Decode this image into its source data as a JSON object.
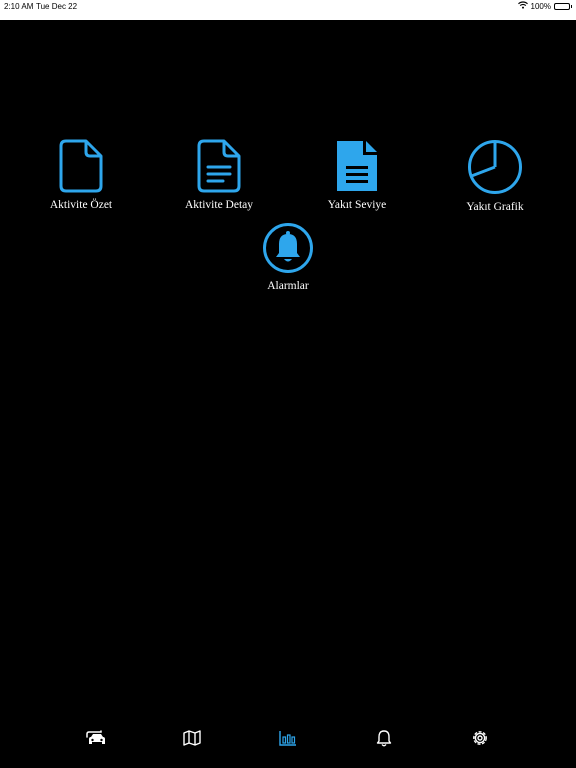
{
  "status_bar": {
    "time": "2:10 AM",
    "date": "Tue Dec 22",
    "battery": "100%"
  },
  "colors": {
    "accent": "#2ea6ec",
    "tab_inactive": "#ffffff",
    "background": "#000000"
  },
  "menu": [
    {
      "label": "Aktivite Özet",
      "icon": "file-outline-icon"
    },
    {
      "label": "Aktivite Detay",
      "icon": "file-lines-outline-icon"
    },
    {
      "label": "Yakıt Seviye",
      "icon": "file-lines-solid-icon"
    },
    {
      "label": "Yakıt Grafik",
      "icon": "pie-chart-icon"
    },
    {
      "label": "Alarmlar",
      "icon": "bell-circle-icon"
    }
  ],
  "tab_bar": {
    "tabs": [
      {
        "icon": "car-garage-icon",
        "active": false
      },
      {
        "icon": "map-icon",
        "active": false
      },
      {
        "icon": "bar-chart-icon",
        "active": true
      },
      {
        "icon": "bell-icon",
        "active": false
      },
      {
        "icon": "gear-icon",
        "active": false
      }
    ]
  }
}
